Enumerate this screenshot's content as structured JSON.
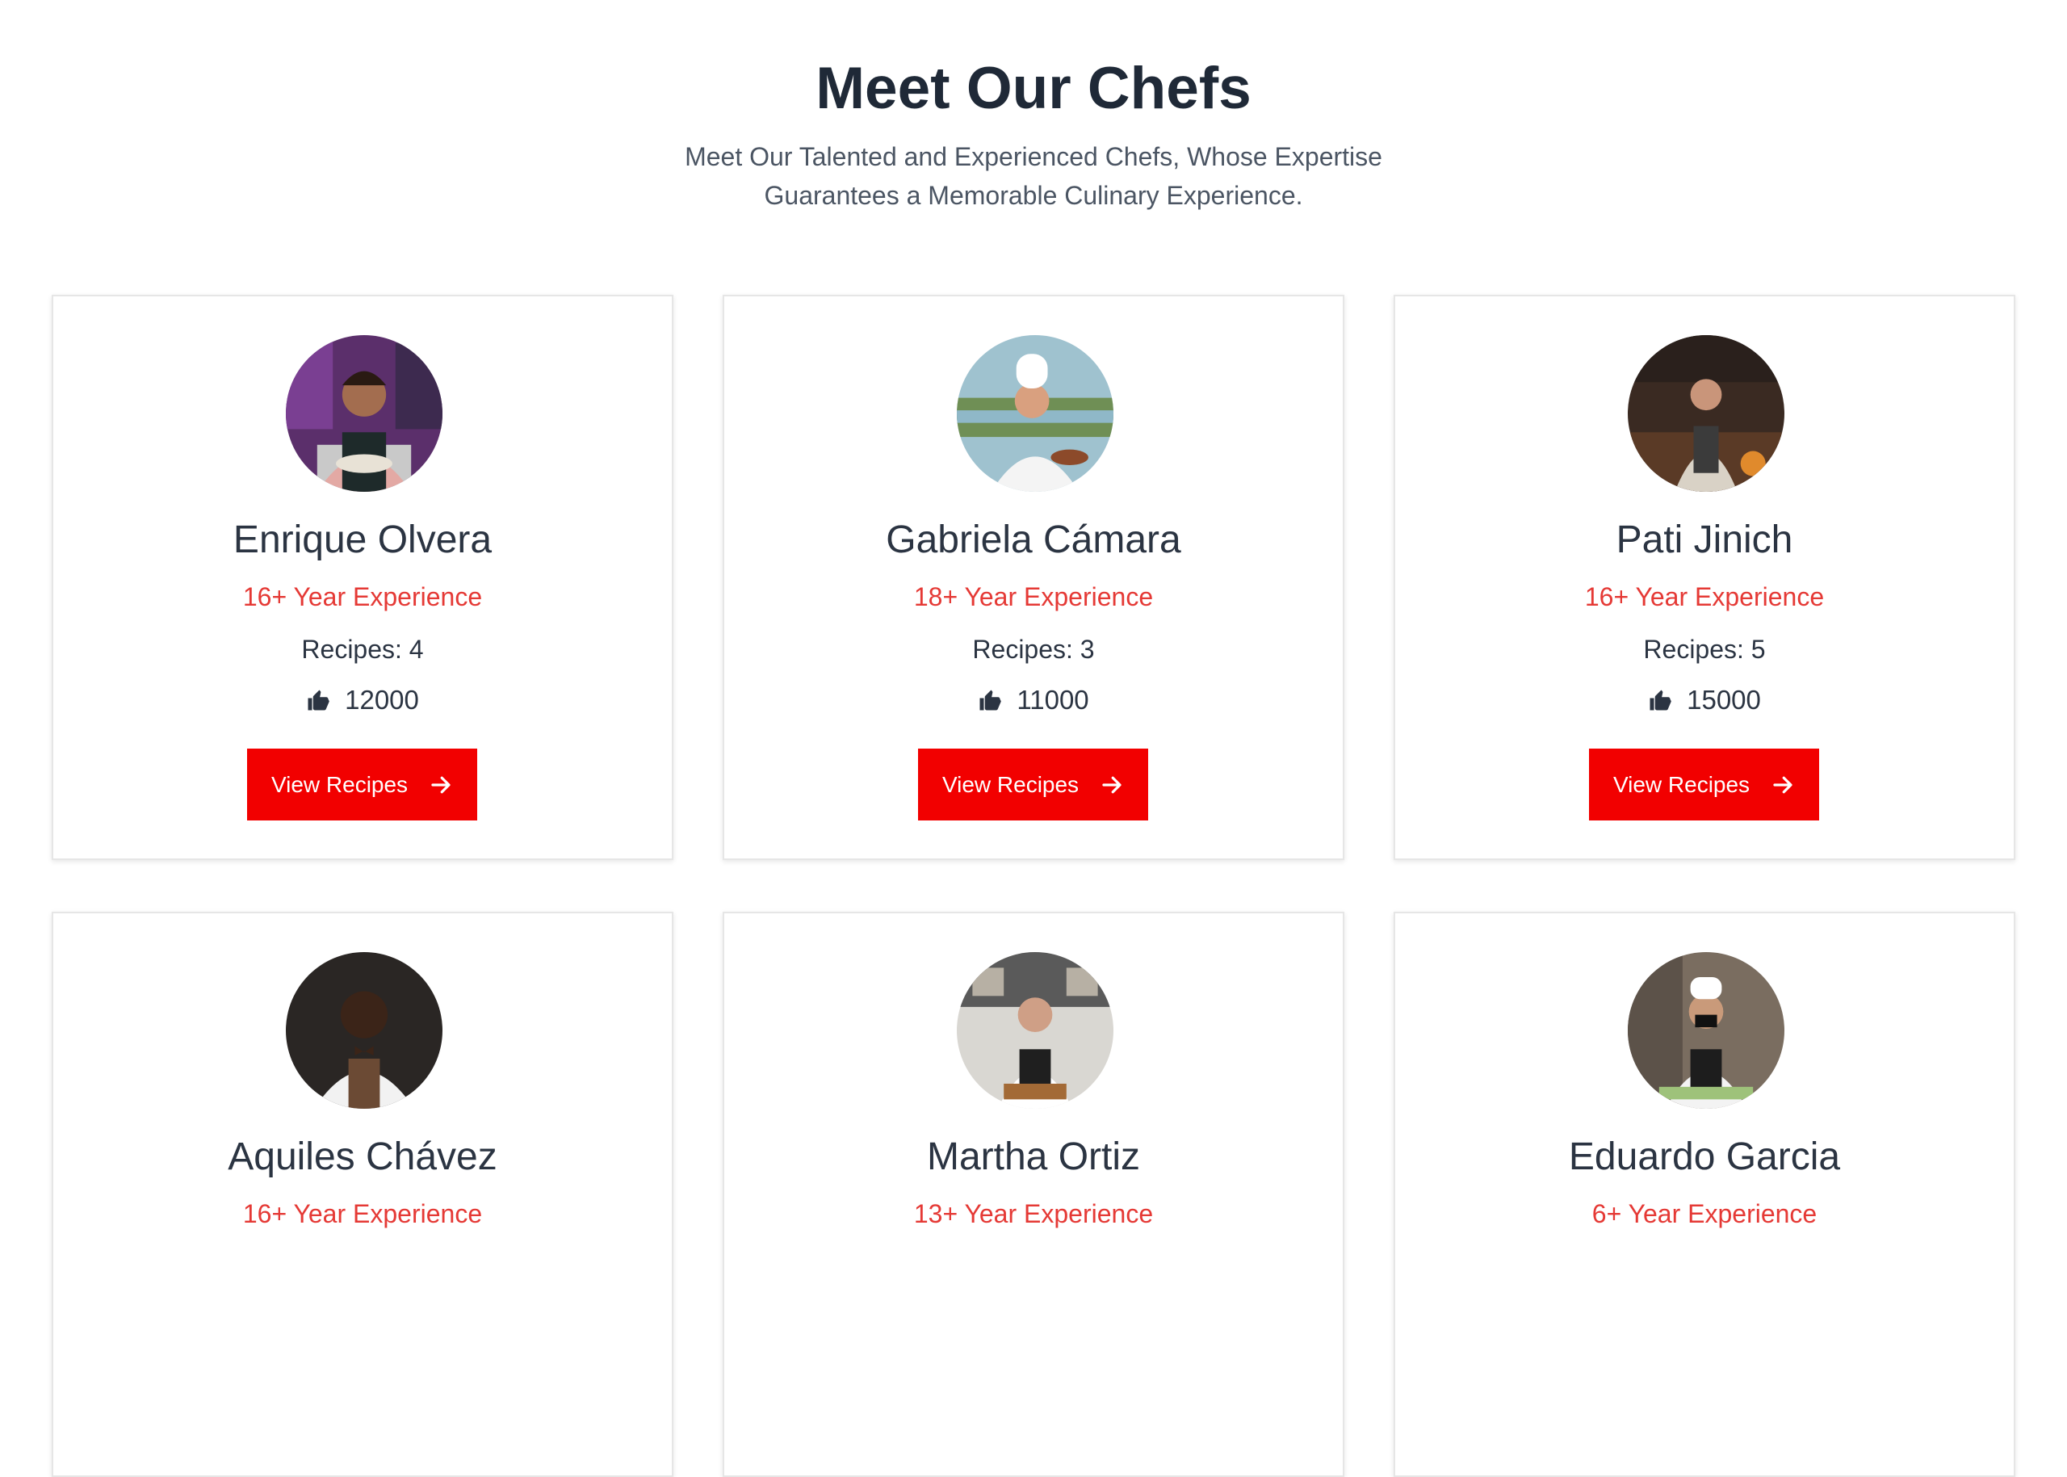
{
  "header": {
    "title": "Meet Our Chefs",
    "subtitle": "Meet Our Talented and Experienced Chefs, Whose Expertise Guarantees a Memorable Culinary Experience."
  },
  "icons": {
    "like": "thumbs-up-icon",
    "arrow": "arrow-right-icon"
  },
  "colors": {
    "accent": "#f20000",
    "experience": "#e53935",
    "text": "#2b3442"
  },
  "chefs": [
    {
      "name": "Enrique Olvera",
      "experience": "16+ Year Experience",
      "recipes": "Recipes: 4",
      "likes": "12000",
      "button": "View Recipes"
    },
    {
      "name": "Gabriela Cámara",
      "experience": "18+ Year Experience",
      "recipes": "Recipes: 3",
      "likes": "11000",
      "button": "View Recipes"
    },
    {
      "name": "Pati Jinich",
      "experience": "16+ Year Experience",
      "recipes": "Recipes: 5",
      "likes": "15000",
      "button": "View Recipes"
    },
    {
      "name": "Aquiles Chávez",
      "experience": "16+ Year Experience",
      "recipes": "",
      "likes": "",
      "button": ""
    },
    {
      "name": "Martha Ortiz",
      "experience": "13+ Year Experience",
      "recipes": "",
      "likes": "",
      "button": ""
    },
    {
      "name": "Eduardo Garcia",
      "experience": "6+ Year Experience",
      "recipes": "",
      "likes": "",
      "button": ""
    }
  ]
}
